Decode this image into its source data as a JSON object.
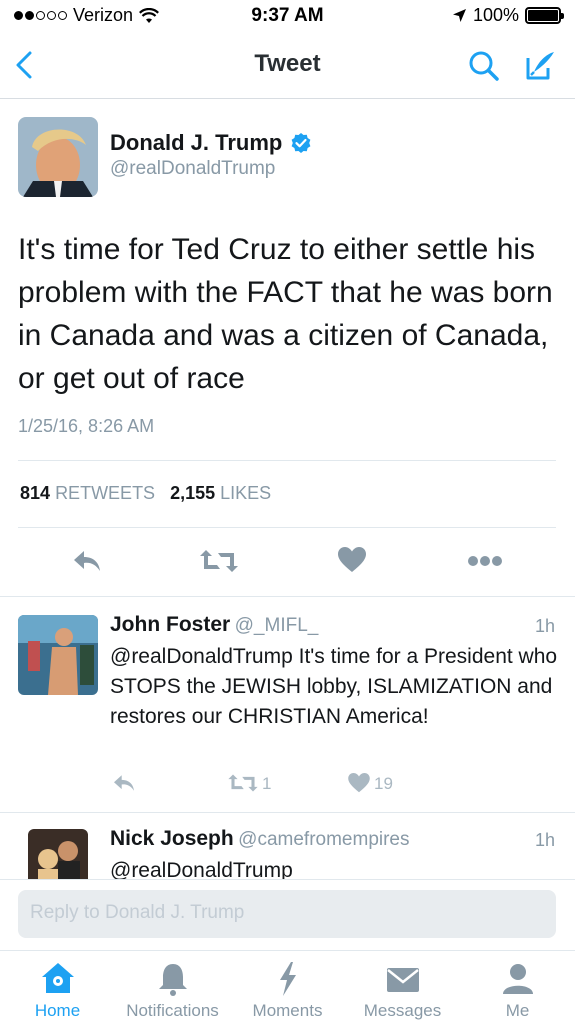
{
  "status_bar": {
    "carrier": "Verizon",
    "time": "9:37 AM",
    "battery": "100%",
    "battery_level": 1.0
  },
  "nav": {
    "title": "Tweet",
    "back_icon": "chevron-left-icon",
    "search_icon": "search-icon",
    "compose_icon": "compose-icon"
  },
  "tweet": {
    "name": "Donald J. Trump",
    "verified": true,
    "handle": "@realDonaldTrump",
    "text": "It's time for Ted Cruz to either settle his problem with the FACT that he was born in Canada and was a citizen of Canada, or get out of race",
    "timestamp": "1/25/16, 8:26 AM",
    "retweets_count": "814",
    "retweets_label": "RETWEETS",
    "likes_count": "2,155",
    "likes_label": "LIKES"
  },
  "replies": [
    {
      "name": "John Foster",
      "handle": "@_MIFL_",
      "time": "1h",
      "text": "@realDonaldTrump It's time for a President who STOPS the JEWISH lobby, ISLAMIZATION and restores our CHRISTIAN America!",
      "retweets": "1",
      "likes": "19"
    },
    {
      "name": "Nick Joseph",
      "handle": "@camefromempires",
      "time": "1h",
      "text": "@realDonaldTrump"
    }
  ],
  "reply_box": {
    "placeholder": "Reply to Donald J. Trump"
  },
  "tabs": [
    {
      "label": "Home",
      "icon": "home-icon",
      "active": true
    },
    {
      "label": "Notifications",
      "icon": "bell-icon",
      "active": false
    },
    {
      "label": "Moments",
      "icon": "lightning-icon",
      "active": false
    },
    {
      "label": "Messages",
      "icon": "envelope-icon",
      "active": false
    },
    {
      "label": "Me",
      "icon": "person-icon",
      "active": false
    }
  ],
  "colors": {
    "accent": "#1da1f2",
    "gray": "#8899a6",
    "light_gray": "#aab8c2"
  }
}
